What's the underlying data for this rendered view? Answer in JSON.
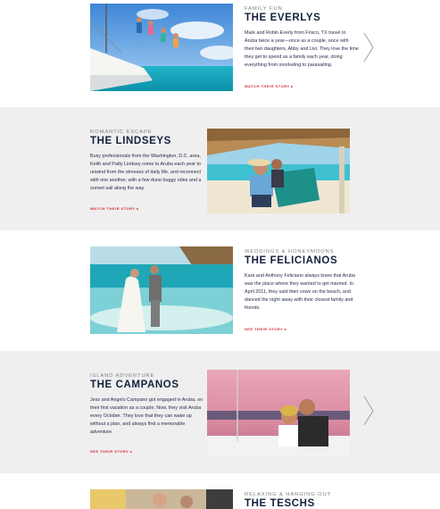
{
  "stories": [
    {
      "kicker": "FAMILY FUN",
      "name": "THE EVERLYS",
      "body": "Mark and Robin Everly from Frisco, TX travel to Aruba twice a year—once as a couple, once with their two daughters, Abby and Livi. They love the time they get to spend as a family each year, doing everything from snorkeling to parasailing.",
      "cta": "WATCH THEIR STORY ▸",
      "photo_icon": "family-jumping-boat-photo"
    },
    {
      "kicker": "ROMANTIC ESCAPE",
      "name": "THE LINDSEYS",
      "body": "Busy professionals from the Washington, D.C. area, Keith and Patty Lindsey come to Aruba each year to unwind from the stresses of daily life, and reconnect with one another, with a few dune buggy rides and a sunset sail along the way.",
      "cta": "WATCH THEIR STORY ▸",
      "photo_icon": "couple-beach-hut-photo"
    },
    {
      "kicker": "WEDDINGS & HONEYMOONS",
      "name": "THE FELICIANOS",
      "body": "Kara and Anthony Feliciano always knew that Aruba was the place where they wanted to get married. In April 2011, they said their vows on the beach, and danced the night away with their closest family and friends.",
      "cta": "SEE THEIR STORY ▸",
      "photo_icon": "wedding-couple-surf-photo"
    },
    {
      "kicker": "ISLAND ADVENTURE",
      "name": "THE CAMPANOS",
      "body": "Jess and Angelo Campano got engaged in Aruba, on their first vacation as a couple. Now, they visit Aruba every October. They love that they can wake up without a plan, and always find a memorable adventure.",
      "cta": "SEE THEIR STORY ▸",
      "photo_icon": "couple-sunset-boat-photo"
    },
    {
      "kicker": "RELAXING & HANGING OUT",
      "name": "THE TESCHS",
      "photo_icon": "couple-indoor-photo"
    }
  ],
  "colors": {
    "navy": "#14213d",
    "accent_red": "#d22630",
    "band_gray": "#efefef",
    "kicker_gray": "#7a7f88"
  },
  "arrows": {
    "icon": "chevron-right-icon"
  }
}
